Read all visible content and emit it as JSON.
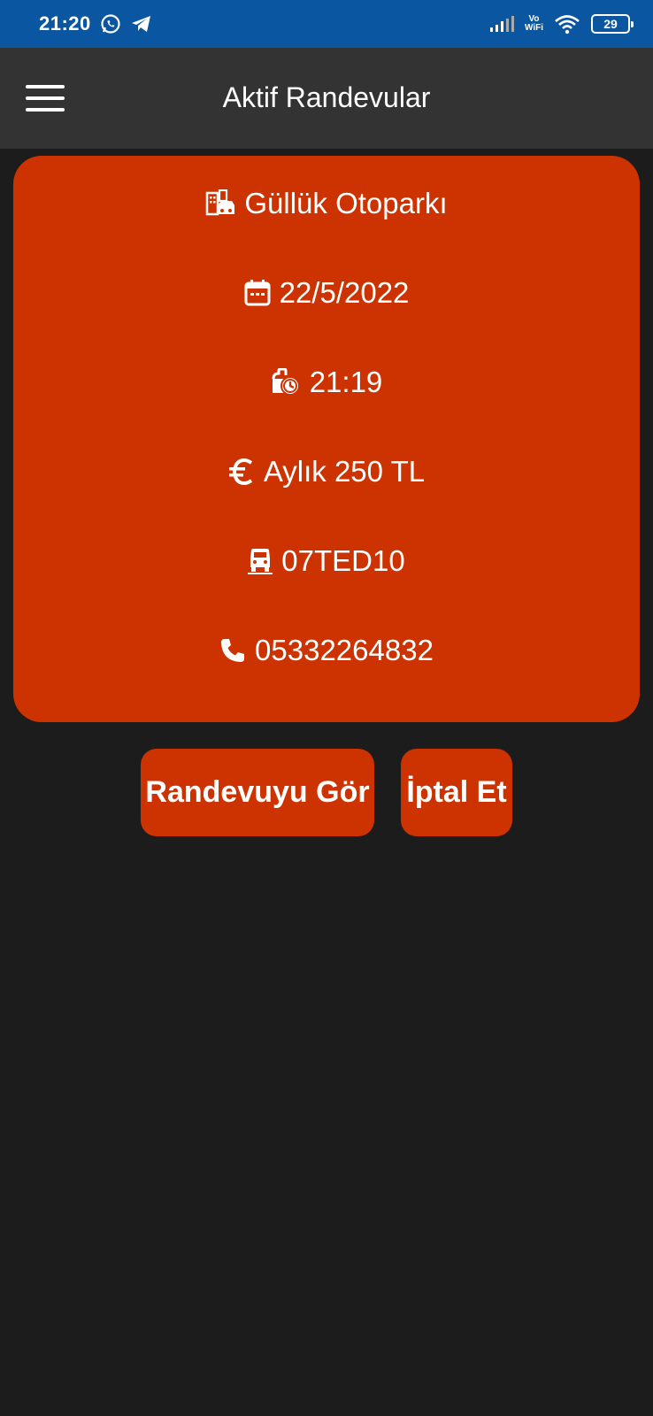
{
  "status_bar": {
    "time": "21:20",
    "network_label": "Vo\nWiFi",
    "battery": "29"
  },
  "app_bar": {
    "title": "Aktif Randevular"
  },
  "appointment": {
    "parking_name": "Güllük Otoparkı",
    "date": "22/5/2022",
    "time": "21:19",
    "price": "Aylık 250 TL",
    "plate": "07TED10",
    "phone": "05332264832"
  },
  "actions": {
    "view_label": "Randevuyu Gör",
    "cancel_label": "İptal Et"
  },
  "colors": {
    "status_bar": "#0a56a0",
    "app_bar": "#333333",
    "background": "#1c1c1c",
    "accent": "#cc3300"
  },
  "icons": [
    "whatsapp-icon",
    "telegram-icon",
    "signal-icon",
    "wifi-icon",
    "parking-building-icon",
    "calendar-icon",
    "clock-icon",
    "euro-icon",
    "car-icon",
    "phone-icon",
    "menu-icon"
  ]
}
